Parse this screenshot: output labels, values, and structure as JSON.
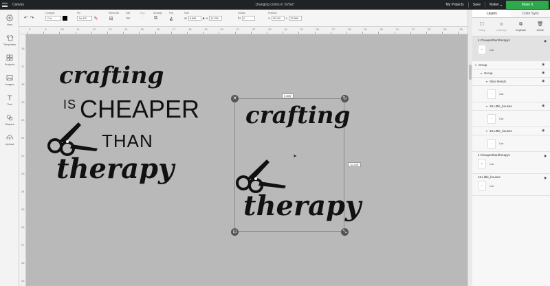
{
  "topbar": {
    "app_title": "Canvas",
    "doc_title": "changing colors in SVGs*",
    "my_projects": "My Projects",
    "save": "Save",
    "machine": "Maker",
    "make_it": "Make It"
  },
  "leftbar": {
    "items": [
      {
        "label": "New",
        "icon": "plus-icon"
      },
      {
        "label": "Templates",
        "icon": "shirt-icon"
      },
      {
        "label": "Projects",
        "icon": "grid-icon"
      },
      {
        "label": "Images",
        "icon": "image-icon"
      },
      {
        "label": "Text",
        "icon": "text-icon"
      },
      {
        "label": "Shapes",
        "icon": "shapes-icon"
      },
      {
        "label": "Upload",
        "icon": "upload-icon"
      }
    ]
  },
  "toolbar": {
    "linetype_label": "Linetype",
    "linetype_value": "Cut",
    "fill_label": "Fill",
    "fill_value": "No Fill",
    "select_all_label": "Select All",
    "edit_label": "Edit",
    "align_label": "Align",
    "arrange_label": "Arrange",
    "flip_label": "Flip",
    "size_label": "Size",
    "size_w_label": "W",
    "size_w": "9.895",
    "size_h_label": "H",
    "size_h": "11.259",
    "rotate_label": "Rotate",
    "rotate_value": "0",
    "position_label": "Position",
    "pos_x_label": "X",
    "pos_x": "20.112",
    "pos_y_label": "Y",
    "pos_y": "23.989"
  },
  "ruler": {
    "h_marks": [
      "8",
      "9",
      "10",
      "11",
      "12",
      "13",
      "14",
      "15",
      "16",
      "17",
      "18",
      "19",
      "20",
      "21",
      "22",
      "23",
      "24",
      "25",
      "26",
      "27",
      "28",
      "29",
      "30",
      "31",
      "32",
      "33",
      "34",
      "35"
    ],
    "v_marks": [
      "16",
      "17",
      "18",
      "19",
      "20",
      "21",
      "22",
      "23",
      "24",
      "25",
      "26",
      "27",
      "28",
      "29"
    ]
  },
  "canvas": {
    "art_left": {
      "line1": "crafting",
      "line2a": "IS",
      "line2b": "CHEAPER",
      "line3": "THAN",
      "line4": "therapy"
    },
    "art_selected": {
      "line1": "crafting",
      "line2": "therapy"
    },
    "width_readout": "9.895\"",
    "height_readout": "11.259\""
  },
  "panel": {
    "tab_layers": "Layers",
    "tab_color_sync": "Color Sync",
    "actions": [
      {
        "label": "Group",
        "icon": "group-icon"
      },
      {
        "label": "UnGroup",
        "icon": "ungroup-icon"
      },
      {
        "label": "Duplicate",
        "icon": "duplicate-icon"
      },
      {
        "label": "Delete",
        "icon": "trash-icon"
      }
    ],
    "layers": {
      "top_name": "4.Cheaperthantherapyc",
      "top_op": "Cut",
      "group1": "Group",
      "group2": "Group",
      "slice": "Slice Result",
      "slice_op": "Cut",
      "houses1": "19.Little_houses",
      "houses1_op": "Cut",
      "houses2": "19.Little_houses",
      "houses2_op": "Cut",
      "cheaper2": "4.Cheaperthantherapyc",
      "cheaper2_op": "Cut",
      "houses3": "19.Little_houses",
      "houses3_op": "Cut"
    }
  }
}
